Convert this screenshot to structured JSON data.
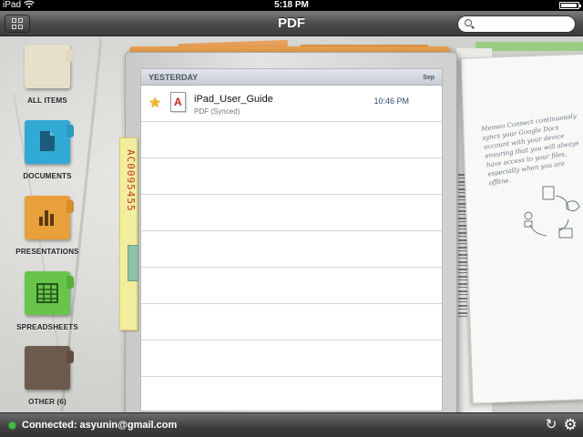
{
  "status_bar": {
    "device": "iPad",
    "time": "5:18 PM"
  },
  "nav": {
    "title": "PDF",
    "search_placeholder": ""
  },
  "sidebar": {
    "items": [
      {
        "label": "ALL ITEMS",
        "color": "#e7dfc9",
        "tab": "#e0d7bf",
        "icon": "folder-icon"
      },
      {
        "label": "DOCUMENTS",
        "color": "#31a9d5",
        "tab": "#2c9bc4",
        "icon": "document-icon"
      },
      {
        "label": "PRESENTATIONS",
        "color": "#e8a13a",
        "tab": "#d68e28",
        "icon": "bar-chart-icon"
      },
      {
        "label": "SPREADSHEETS",
        "color": "#68c44a",
        "tab": "#55b038",
        "icon": "spreadsheet-icon"
      },
      {
        "label": "OTHER (6)",
        "color": "#6c5a4c",
        "tab": "#5e4d41",
        "icon": "misc-icon"
      }
    ]
  },
  "list": {
    "section": "YESTERDAY",
    "month": "Sep",
    "documents": [
      {
        "name": "iPad_User_Guide",
        "subtitle": "PDF (Synced)",
        "time": "10:46 PM",
        "starred": true
      }
    ]
  },
  "decor": {
    "tag_code": "AC0095455",
    "note_text": "Memeo Connect continuously syncs your Google Docs account with your device ensuring that you will always have access to your files, especially when you are offline."
  },
  "bottom_bar": {
    "connection": "Connected: asyunin@gmail.com",
    "status_color": "#38c23a"
  }
}
